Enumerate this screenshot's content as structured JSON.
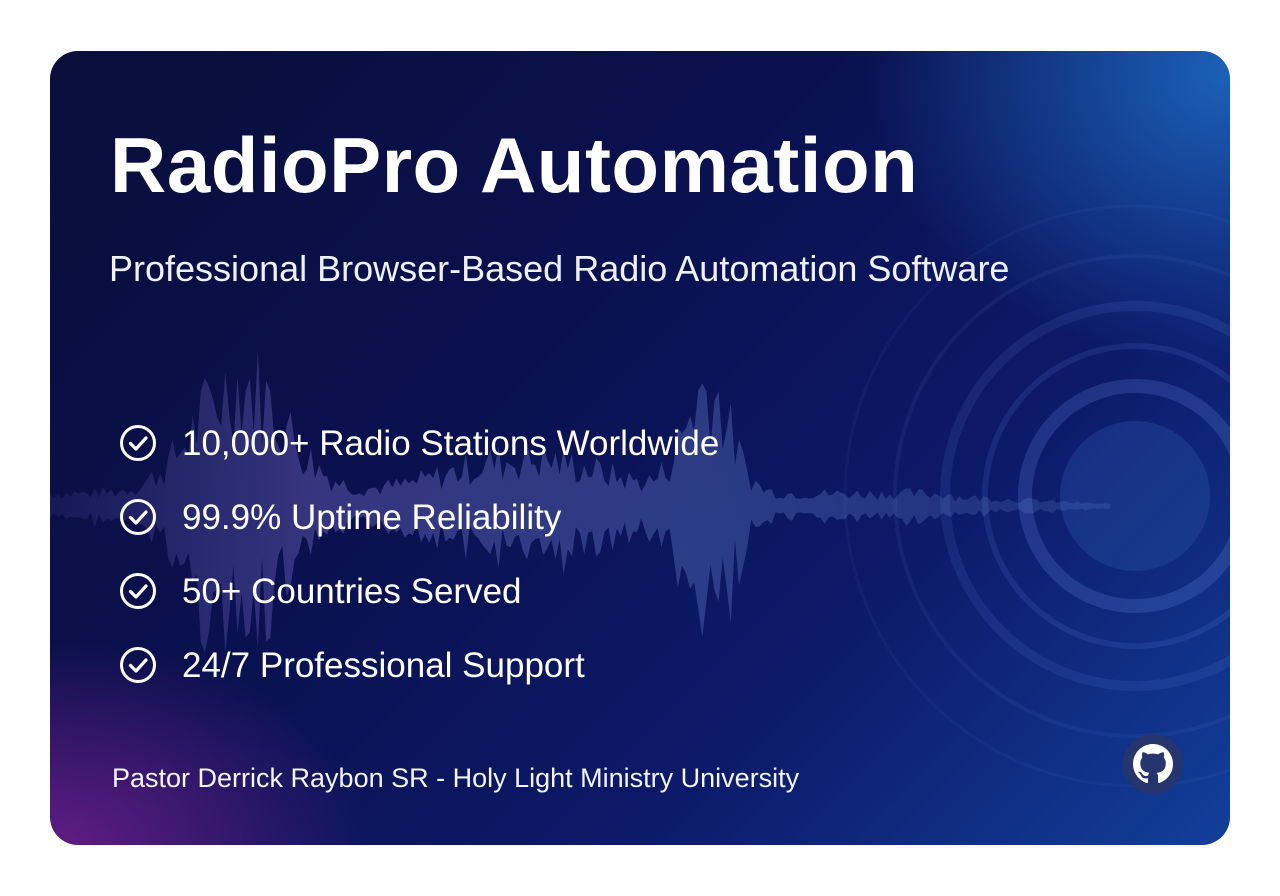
{
  "title": "RadioPro Automation",
  "subtitle": "Professional Browser-Based Radio Automation Software",
  "features": [
    {
      "label": "10,000+ Radio Stations Worldwide",
      "icon": "check-circle-icon"
    },
    {
      "label": "99.9% Uptime Reliability",
      "icon": "check-circle-icon"
    },
    {
      "label": "50+ Countries Served",
      "icon": "check-circle-icon"
    },
    {
      "label": "24/7 Professional Support",
      "icon": "check-circle-icon"
    }
  ],
  "footer": "Pastor Derrick Raybon SR - Holy Light Ministry University",
  "logo_icon": "github-octocat-icon",
  "colors": {
    "background_dark": "#0a0e3a",
    "background_blue": "#1e6ec8",
    "background_purple": "#6e1e8c",
    "text": "#ffffff"
  }
}
